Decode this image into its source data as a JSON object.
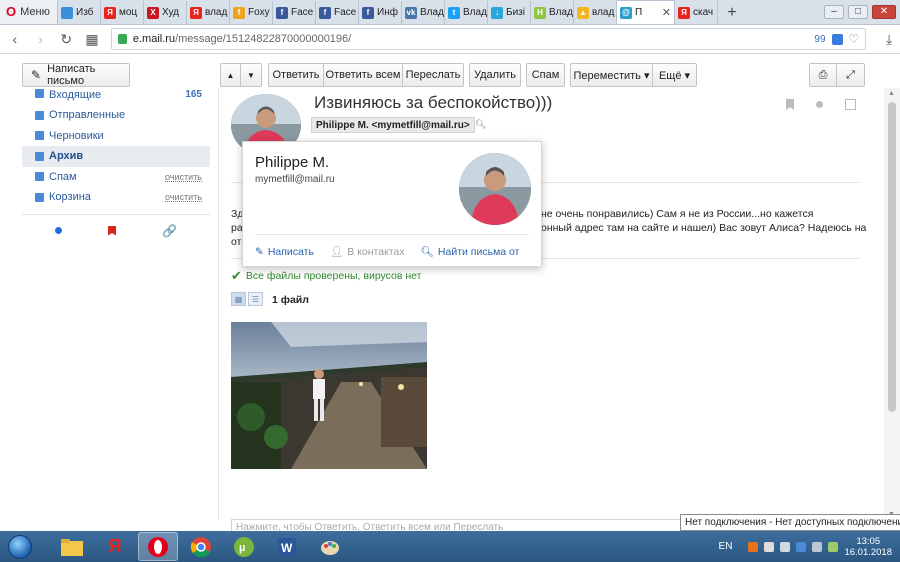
{
  "browser": {
    "menu_label": "Меню",
    "tabs": [
      {
        "label": "Изб",
        "color": "#3b8fd9",
        "glyph": ""
      },
      {
        "label": "моц",
        "color": "#e8231e",
        "glyph": "Я"
      },
      {
        "label": "Худ",
        "color": "#c8181e",
        "glyph": "X"
      },
      {
        "label": "влад",
        "color": "#e8231e",
        "glyph": "Я"
      },
      {
        "label": "Foxy",
        "color": "#f0a31e",
        "glyph": "f"
      },
      {
        "label": "Face",
        "color": "#3b5998",
        "glyph": "f"
      },
      {
        "label": "Face",
        "color": "#3b5998",
        "glyph": "f"
      },
      {
        "label": "Инф",
        "color": "#3b5998",
        "glyph": "f"
      },
      {
        "label": "Влад",
        "color": "#4a76a8",
        "glyph": "vk"
      },
      {
        "label": "Влад",
        "color": "#1da1f2",
        "glyph": "t"
      },
      {
        "label": "Бизі",
        "color": "#2aa6d9",
        "glyph": "↓"
      },
      {
        "label": "Влад",
        "color": "#8dc63f",
        "glyph": "H"
      },
      {
        "label": "влад",
        "color": "#f3b61f",
        "glyph": "▲"
      },
      {
        "label": "П",
        "color": "#2aa0c8",
        "glyph": "@",
        "active": true
      },
      {
        "label": "скач",
        "color": "#e8231e",
        "glyph": "Я"
      }
    ],
    "url_host": "e.mail.ru",
    "url_path": "/message/15124822870000000196/",
    "badge_count": "99"
  },
  "toolbar": {
    "compose": "Написать письмо",
    "reply": "Ответить",
    "reply_all": "Ответить всем",
    "forward": "Переслать",
    "delete": "Удалить",
    "spam": "Спам",
    "move": "Переместить ▾",
    "more": "Ещё ▾"
  },
  "sidebar": {
    "items": [
      {
        "label": "Входящие",
        "count": "165",
        "color": "#4a8ad6"
      },
      {
        "label": "Отправленные",
        "color": "#4a8ad6"
      },
      {
        "label": "Черновики",
        "color": "#4a8ad6"
      },
      {
        "label": "Архив",
        "color": "#4a8ad6",
        "active": true
      },
      {
        "label": "Спам",
        "clear": "очистить",
        "color": "#4a8ad6"
      },
      {
        "label": "Корзина",
        "clear": "очистить",
        "color": "#4a8ad6"
      }
    ]
  },
  "message": {
    "subject": "Извиняюсь за беспокойство)))",
    "sender": "Philippe M. <mymetfill@mail.ru>",
    "body_line1_left": "Зд",
    "body_line1_right": "не очень понравились) Сам я не из России...но кажется",
    "body_line2_left": "ра",
    "body_line2_right": "онный адрес там на сайте и нашел) Вас зовут Алиса? Надеюсь на",
    "body_line3_left": "от",
    "virus_check": "Все файлы проверены, вирусов нет",
    "files_count": "1 файл",
    "reply_placeholder": "Нажмите, чтобы Ответить, Ответить всем или Переслать"
  },
  "contact_card": {
    "name": "Philippe M.",
    "email": "mymetfill@mail.ru",
    "write": "Написать",
    "in_contacts": "В контактах",
    "find_letters": "Найти письма от"
  },
  "tooltip": "Нет подключения - Нет доступных подключений",
  "taskbar": {
    "lang": "EN",
    "time": "13:05",
    "date": "16.01.2018"
  }
}
